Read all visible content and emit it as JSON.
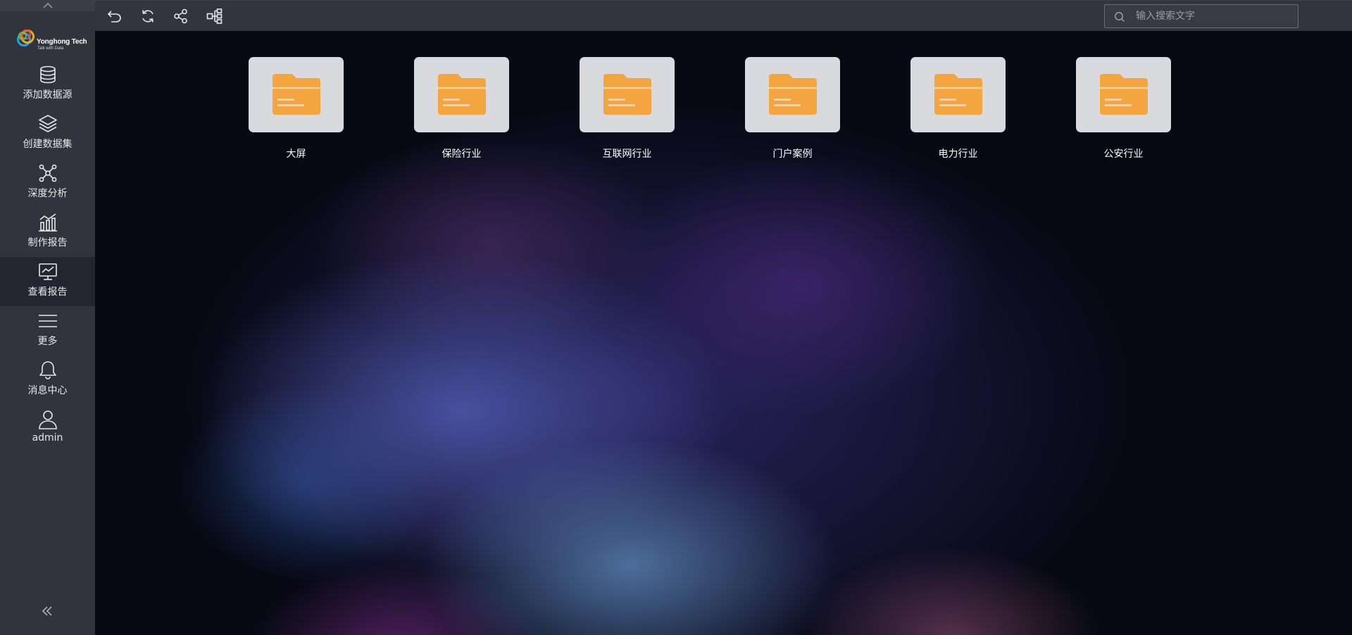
{
  "brand": {
    "logo_text": "Yonghong Tech",
    "logo_subtitle": "Talk with Data"
  },
  "sidebar": {
    "items": [
      {
        "label": "添加数据源",
        "icon": "database-icon",
        "active": false
      },
      {
        "label": "创建数据集",
        "icon": "layers-icon",
        "active": false
      },
      {
        "label": "深度分析",
        "icon": "network-nodes-icon",
        "active": false
      },
      {
        "label": "制作报告",
        "icon": "bar-chart-icon",
        "active": false
      },
      {
        "label": "查看报告",
        "icon": "monitor-chart-icon",
        "active": true
      },
      {
        "label": "更多",
        "icon": "menu-lines-icon",
        "active": false
      },
      {
        "label": "消息中心",
        "icon": "bell-icon",
        "active": false
      },
      {
        "label": "admin",
        "icon": "user-icon",
        "active": false
      }
    ]
  },
  "toolbar": {
    "buttons": [
      "back-icon",
      "refresh-icon",
      "share-icon",
      "tree-structure-icon"
    ]
  },
  "search": {
    "placeholder": "输入搜索文字"
  },
  "folders": [
    {
      "name": "大屏"
    },
    {
      "name": "保险行业"
    },
    {
      "name": "互联网行业"
    },
    {
      "name": "门户案例"
    },
    {
      "name": "电力行业"
    },
    {
      "name": "公安行业"
    }
  ],
  "colors": {
    "sidebar_bg": "#31343d",
    "sidebar_active_bg": "#23262e",
    "toolbar_bg": "#32353e",
    "folder_tile_bg": "#d9dadd",
    "folder_icon": "#f5a540"
  }
}
